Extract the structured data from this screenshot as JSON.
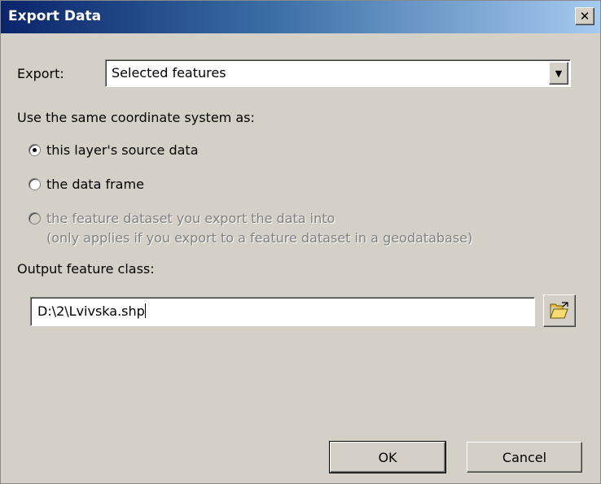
{
  "window": {
    "title": "Export Data",
    "close_glyph": "✕"
  },
  "export": {
    "label": "Export:",
    "selected": "Selected features",
    "arrow_glyph": "▼"
  },
  "coordinate": {
    "heading": "Use the same coordinate system as:",
    "options": [
      {
        "label": "this layer's source data",
        "checked": true,
        "enabled": true
      },
      {
        "label": "the data frame",
        "checked": false,
        "enabled": true
      },
      {
        "label": "the feature dataset you export the data into",
        "sublabel": "(only applies if you export to a feature dataset in a geodatabase)",
        "checked": false,
        "enabled": false
      }
    ]
  },
  "output": {
    "label": "Output feature class:",
    "value": "D:\\2\\Lvivska.shp",
    "browse_icon": "open-folder-icon"
  },
  "buttons": {
    "ok": "OK",
    "cancel": "Cancel"
  },
  "colors": {
    "title_start": "#0a246a",
    "title_end": "#a6caf0",
    "face": "#d4d0c8",
    "disabled_text": "#808080"
  }
}
